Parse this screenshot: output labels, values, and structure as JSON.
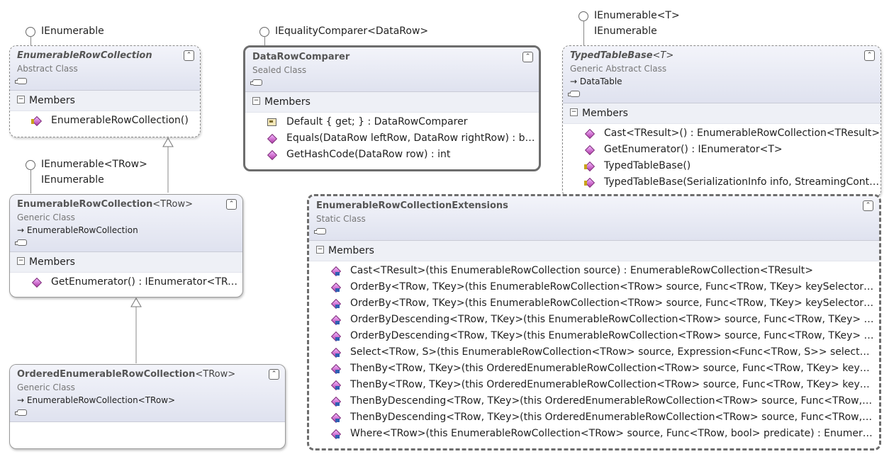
{
  "interfaces": {
    "ienumerable_top": "IEnumerable",
    "iequality": "IEqualityComparer<DataRow>",
    "typed_line1": "IEnumerable<T>",
    "typed_line2": "IEnumerable",
    "generic_line1": "IEnumerable<TRow>",
    "generic_line2": "IEnumerable"
  },
  "section_label": "Members",
  "classes": {
    "erc": {
      "title": "EnumerableRowCollection",
      "kind": "Abstract Class",
      "members": [
        "EnumerableRowCollection()"
      ]
    },
    "drc": {
      "title": "DataRowComparer",
      "kind": "Sealed Class",
      "members": [
        "Default { get; } : DataRowComparer",
        "Equals(DataRow leftRow, DataRow rightRow) : bool",
        "GetHashCode(DataRow row) : int"
      ]
    },
    "ttb": {
      "title": "TypedTableBase",
      "type_params": "<T>",
      "kind": "Generic Abstract Class",
      "base": "DataTable",
      "members": [
        "Cast<TResult>() : EnumerableRowCollection<TResult>",
        "GetEnumerator() : IEnumerator<T>",
        "TypedTableBase()",
        "TypedTableBase(SerializationInfo info, StreamingConte…"
      ]
    },
    "ercg": {
      "title": "EnumerableRowCollection",
      "type_params": "<TRow>",
      "kind": "Generic Class",
      "base": "EnumerableRowCollection",
      "members": [
        "GetEnumerator() : IEnumerator<TRow>"
      ]
    },
    "erce": {
      "title": "EnumerableRowCollectionExtensions",
      "kind": "Static Class",
      "members": [
        "Cast<TResult>(this EnumerableRowCollection source) : EnumerableRowCollection<TResult>",
        "OrderBy<TRow, TKey>(this EnumerableRowCollection<TRow> source, Func<TRow, TKey> keySelector) : Or…",
        "OrderBy<TRow, TKey>(this EnumerableRowCollection<TRow> source, Func<TRow, TKey> keySelector, ICo…",
        "OrderByDescending<TRow, TKey>(this EnumerableRowCollection<TRow> source, Func<TRow, TKey> keySe…",
        "OrderByDescending<TRow, TKey>(this EnumerableRowCollection<TRow> source, Func<TRow, TKey> keySe…",
        "Select<TRow, S>(this EnumerableRowCollection<TRow> source, Expression<Func<TRow, S>> selector) : En…",
        "ThenBy<TRow, TKey>(this OrderedEnumerableRowCollection<TRow> source, Func<TRow, TKey> keySelect…",
        "ThenBy<TRow, TKey>(this OrderedEnumerableRowCollection<TRow> source, Func<TRow, TKey> keySelect…",
        "ThenByDescending<TRow, TKey>(this OrderedEnumerableRowCollection<TRow> source, Func<TRow, TKey…",
        "ThenByDescending<TRow, TKey>(this OrderedEnumerableRowCollection<TRow> source, Func<TRow, TKey…",
        "Where<TRow>(this EnumerableRowCollection<TRow> source, Func<TRow, bool> predicate) : EnumerableR…"
      ]
    },
    "oerc": {
      "title": "OrderedEnumerableRowCollection",
      "type_params": "<TRow>",
      "kind": "Generic Class",
      "base": "EnumerableRowCollection<TRow>"
    }
  }
}
